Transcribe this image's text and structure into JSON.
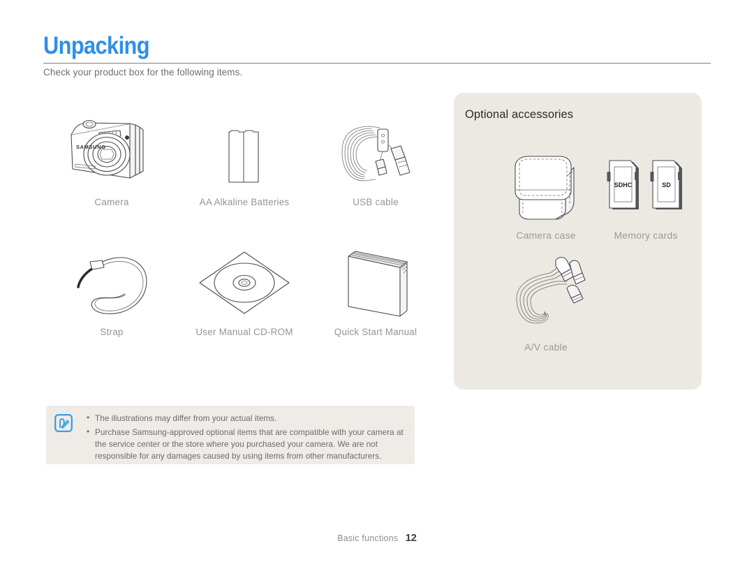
{
  "header": {
    "title": "Unpacking",
    "intro": "Check your product box for the following items."
  },
  "items": [
    {
      "label": "Camera",
      "icon": "camera-icon"
    },
    {
      "label": "AA Alkaline Batteries",
      "icon": "batteries-icon"
    },
    {
      "label": "USB cable",
      "icon": "usb-cable-icon"
    },
    {
      "label": "Strap",
      "icon": "strap-icon"
    },
    {
      "label": "User Manual CD-ROM",
      "icon": "cdrom-icon"
    },
    {
      "label": "Quick Start Manual",
      "icon": "booklet-icon"
    }
  ],
  "optional": {
    "heading": "Optional accessories",
    "items": [
      {
        "label": "Camera case",
        "icon": "camera-case-icon"
      },
      {
        "label": "Memory cards",
        "icon": "memory-cards-icon",
        "card_labels": [
          "SDHC",
          "SD"
        ]
      },
      {
        "label": "A/V cable",
        "icon": "av-cable-icon"
      }
    ]
  },
  "note": {
    "icon": "note-pencil-icon",
    "lines": [
      "The illustrations may differ from your actual items.",
      "Purchase Samsung-approved optional items that are compatible with your camera at the service center or the store where you purchased your camera. We are not responsible for any damages caused by using items from other manufacturers."
    ]
  },
  "brand": {
    "camera_logo": "SAMSUNG"
  },
  "footer": {
    "section": "Basic functions",
    "page": "12"
  },
  "colors": {
    "title_blue": "#2f8fe8",
    "panel_bg": "#ece9e3",
    "note_bg": "#efece7",
    "label_gray": "#949599"
  }
}
